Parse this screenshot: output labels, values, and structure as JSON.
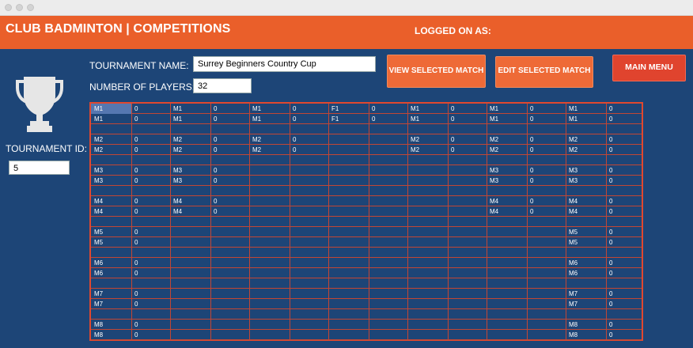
{
  "app": {
    "title": "CLUB BADMINTON | COMPETITIONS",
    "logged_on_label": "LOGGED ON AS:"
  },
  "form": {
    "tournament_name_label": "TOURNAMENT NAME:",
    "tournament_name_value": "Surrey Beginners Country Cup",
    "players_label": "NUMBER OF PLAYERS:",
    "players_value": "32",
    "tournament_id_label": "TOURNAMENT ID:",
    "tournament_id_value": "5"
  },
  "buttons": {
    "view": "VIEW SELECTED MATCH",
    "edit": "EDIT SELECTED MATCH",
    "main_menu": "MAIN MENU"
  },
  "table": {
    "rows": [
      [
        "M1",
        "0",
        "M1",
        "0",
        "M1",
        "0",
        "F1",
        "0",
        "M1",
        "0",
        "M1",
        "0",
        "M1",
        "0"
      ],
      [
        "M1",
        "0",
        "M1",
        "0",
        "M1",
        "0",
        "F1",
        "0",
        "M1",
        "0",
        "M1",
        "0",
        "M1",
        "0"
      ],
      [
        "",
        "",
        "",
        "",
        "",
        "",
        "",
        "",
        "",
        "",
        "",
        "",
        "",
        ""
      ],
      [
        "M2",
        "0",
        "M2",
        "0",
        "M2",
        "0",
        "",
        "",
        "M2",
        "0",
        "M2",
        "0",
        "M2",
        "0"
      ],
      [
        "M2",
        "0",
        "M2",
        "0",
        "M2",
        "0",
        "",
        "",
        "M2",
        "0",
        "M2",
        "0",
        "M2",
        "0"
      ],
      [
        "",
        "",
        "",
        "",
        "",
        "",
        "",
        "",
        "",
        "",
        "",
        "",
        "",
        ""
      ],
      [
        "M3",
        "0",
        "M3",
        "0",
        "",
        "",
        "",
        "",
        "",
        "",
        "M3",
        "0",
        "M3",
        "0"
      ],
      [
        "M3",
        "0",
        "M3",
        "0",
        "",
        "",
        "",
        "",
        "",
        "",
        "M3",
        "0",
        "M3",
        "0"
      ],
      [
        "",
        "",
        "",
        "",
        "",
        "",
        "",
        "",
        "",
        "",
        "",
        "",
        "",
        ""
      ],
      [
        "M4",
        "0",
        "M4",
        "0",
        "",
        "",
        "",
        "",
        "",
        "",
        "M4",
        "0",
        "M4",
        "0"
      ],
      [
        "M4",
        "0",
        "M4",
        "0",
        "",
        "",
        "",
        "",
        "",
        "",
        "M4",
        "0",
        "M4",
        "0"
      ],
      [
        "",
        "",
        "",
        "",
        "",
        "",
        "",
        "",
        "",
        "",
        "",
        "",
        "",
        ""
      ],
      [
        "M5",
        "0",
        "",
        "",
        "",
        "",
        "",
        "",
        "",
        "",
        "",
        "",
        "M5",
        "0"
      ],
      [
        "M5",
        "0",
        "",
        "",
        "",
        "",
        "",
        "",
        "",
        "",
        "",
        "",
        "M5",
        "0"
      ],
      [
        "",
        "",
        "",
        "",
        "",
        "",
        "",
        "",
        "",
        "",
        "",
        "",
        "",
        ""
      ],
      [
        "M6",
        "0",
        "",
        "",
        "",
        "",
        "",
        "",
        "",
        "",
        "",
        "",
        "M6",
        "0"
      ],
      [
        "M6",
        "0",
        "",
        "",
        "",
        "",
        "",
        "",
        "",
        "",
        "",
        "",
        "M6",
        "0"
      ],
      [
        "",
        "",
        "",
        "",
        "",
        "",
        "",
        "",
        "",
        "",
        "",
        "",
        "",
        ""
      ],
      [
        "M7",
        "0",
        "",
        "",
        "",
        "",
        "",
        "",
        "",
        "",
        "",
        "",
        "M7",
        "0"
      ],
      [
        "M7",
        "0",
        "",
        "",
        "",
        "",
        "",
        "",
        "",
        "",
        "",
        "",
        "M7",
        "0"
      ],
      [
        "",
        "",
        "",
        "",
        "",
        "",
        "",
        "",
        "",
        "",
        "",
        "",
        "",
        ""
      ],
      [
        "M8",
        "0",
        "",
        "",
        "",
        "",
        "",
        "",
        "",
        "",
        "",
        "",
        "M8",
        "0"
      ],
      [
        "M8",
        "0",
        "",
        "",
        "",
        "",
        "",
        "",
        "",
        "",
        "",
        "",
        "M8",
        "0"
      ]
    ]
  }
}
